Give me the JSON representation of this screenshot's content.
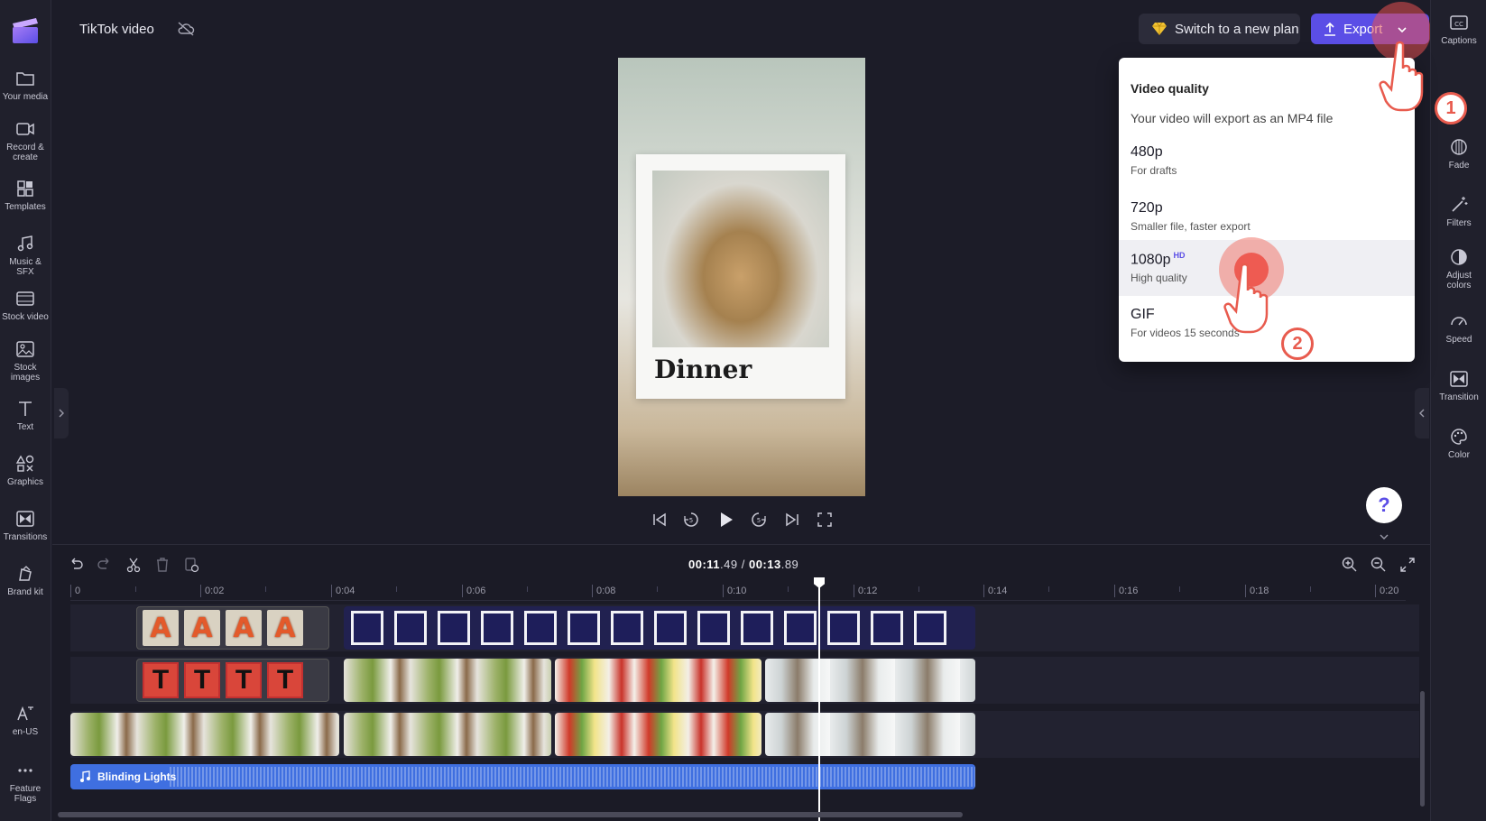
{
  "app": {
    "project_title": "TikTok video"
  },
  "left_nav": {
    "items": [
      {
        "label": "Your media",
        "icon": "folder-icon"
      },
      {
        "label": "Record &\ncreate",
        "icon": "camera-icon"
      },
      {
        "label": "Templates",
        "icon": "templates-icon"
      },
      {
        "label": "Music & SFX",
        "icon": "music-icon"
      },
      {
        "label": "Stock video",
        "icon": "film-icon"
      },
      {
        "label": "Stock\nimages",
        "icon": "image-icon"
      },
      {
        "label": "Text",
        "icon": "text-icon"
      },
      {
        "label": "Graphics",
        "icon": "shapes-icon"
      },
      {
        "label": "Transitions",
        "icon": "transition-icon"
      },
      {
        "label": "Brand kit",
        "icon": "brand-icon"
      }
    ],
    "bottom": [
      {
        "label": "en-US",
        "icon": "language-icon"
      },
      {
        "label": "Feature\nFlags",
        "icon": "more-icon"
      }
    ]
  },
  "header": {
    "plan_button": "Switch to a new plan",
    "export_button": "Export"
  },
  "right_nav": {
    "items": [
      {
        "label": "Captions",
        "icon": "captions-icon"
      },
      {
        "label": "Fade",
        "icon": "fade-icon"
      },
      {
        "label": "Filters",
        "icon": "filters-icon"
      },
      {
        "label": "Adjust\ncolors",
        "icon": "adjust-colors-icon"
      },
      {
        "label": "Speed",
        "icon": "speed-icon"
      },
      {
        "label": "Transition",
        "icon": "transition-icon"
      },
      {
        "label": "Color",
        "icon": "palette-icon"
      }
    ]
  },
  "preview": {
    "caption": "Dinner"
  },
  "export_menu": {
    "title": "Video quality",
    "subtitle": "Your video will export as an MP4 file",
    "options": [
      {
        "quality": "480p",
        "badge": "",
        "description": "For drafts"
      },
      {
        "quality": "720p",
        "badge": "",
        "description": "Smaller file, faster export"
      },
      {
        "quality": "1080p",
        "badge": "HD",
        "description": "High quality"
      },
      {
        "quality": "GIF",
        "badge": "",
        "description": "For videos 15 seconds"
      }
    ],
    "highlighted_option": "1080p"
  },
  "steps": {
    "step1": "1",
    "step2": "2"
  },
  "help": {
    "label": "?"
  },
  "timeline": {
    "current_time": "00:11",
    "current_frac": ".49",
    "total_time": "00:13",
    "total_frac": ".89",
    "ruler_labels": [
      "0",
      "0:02",
      "0:04",
      "0:06",
      "0:08",
      "0:10",
      "0:12",
      "0:14",
      "0:16",
      "0:18",
      "0:20"
    ],
    "audio_track": "Blinding Lights",
    "text_sticker_a": "A",
    "text_sticker_t": "T"
  },
  "colors": {
    "accent": "#5b4ee6",
    "audio": "#3f6fe0",
    "highlight": "#e85b4e"
  }
}
